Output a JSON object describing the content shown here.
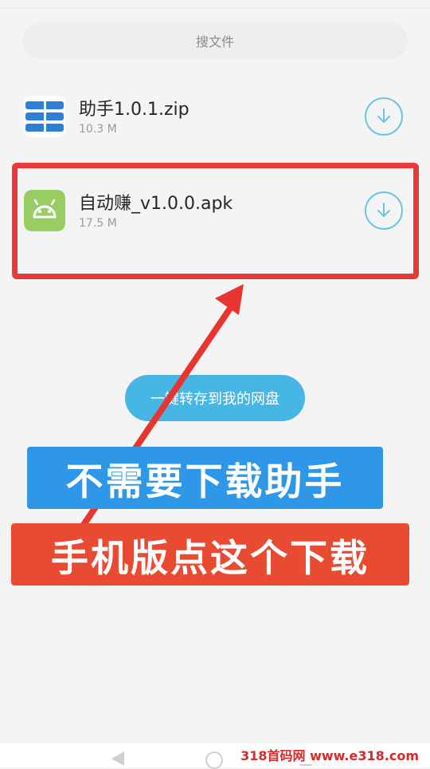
{
  "search": {
    "label": "搜文件"
  },
  "files": [
    {
      "name": "助手1.0.1.zip",
      "size": "10.3 M",
      "icon": "archive-icon"
    },
    {
      "name": "自动赚_v1.0.0.apk",
      "size": "17.5 M",
      "icon": "android-icon"
    }
  ],
  "save_button": {
    "label": "一键转存到我的网盘"
  },
  "annotations": {
    "banner_top": "不需要下载助手",
    "banner_bottom": "手机版点这个下载"
  },
  "watermark": "318首码网 www.e318.com",
  "colors": {
    "accent": "#46b7e5",
    "highlight": "#e83a3a",
    "banner_blue": "#2f97e8",
    "banner_red": "#e84a32"
  }
}
